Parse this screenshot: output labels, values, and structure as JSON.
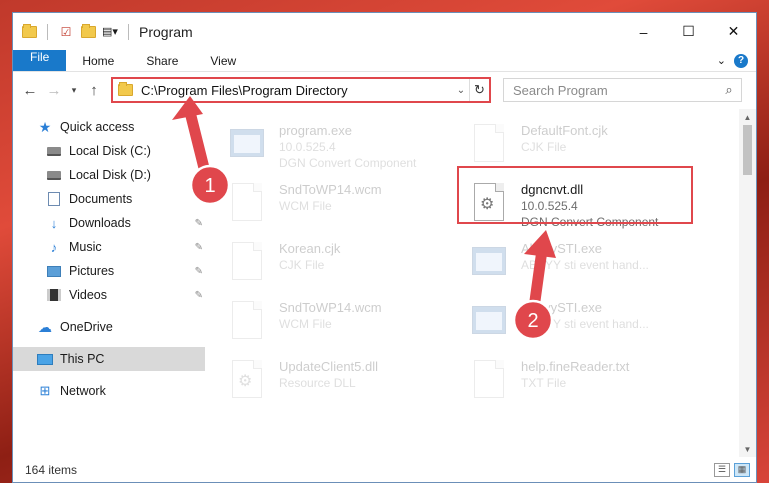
{
  "window": {
    "title": "Program"
  },
  "controls": {
    "minimize": "–",
    "maximize": "☐",
    "close": "✕"
  },
  "ribbon": {
    "tabs": [
      "File",
      "Home",
      "Share",
      "View"
    ]
  },
  "address": {
    "path": "C:\\Program Files\\Program Directory"
  },
  "search": {
    "placeholder": "Search Program"
  },
  "sidebar": {
    "items": [
      {
        "label": "Quick access"
      },
      {
        "label": "Local Disk (C:)"
      },
      {
        "label": "Local Disk (D:)"
      },
      {
        "label": "Documents"
      },
      {
        "label": "Downloads"
      },
      {
        "label": "Music"
      },
      {
        "label": "Pictures"
      },
      {
        "label": "Videos"
      },
      {
        "label": "OneDrive"
      },
      {
        "label": "This PC"
      },
      {
        "label": "Network"
      }
    ]
  },
  "files": [
    {
      "name": "program.exe",
      "line1": "10.0.525.4",
      "line2": "DGN Convert Component"
    },
    {
      "name": "DefaultFont.cjk",
      "line1": "CJK File"
    },
    {
      "name": "SndToWP14.wcm",
      "line1": "WCM File"
    },
    {
      "name": "dgncnvt.dll",
      "line1": "10.0.525.4",
      "line2": "DGN Convert Component"
    },
    {
      "name": "Korean.cjk",
      "line1": "CJK File"
    },
    {
      "name": "AbbyySTI.exe",
      "line1": "ABBYY sti event hand..."
    },
    {
      "name": "SndToWP14.wcm",
      "line1": "WCM File"
    },
    {
      "name": "AbbyySTI.exe",
      "line1": "ABBYY sti event hand..."
    },
    {
      "name": "UpdateClient5.dll",
      "line1": "Resource DLL"
    },
    {
      "name": "help.fineReader.txt",
      "line1": "TXT File"
    }
  ],
  "status": {
    "count": "164 items"
  },
  "annotations": {
    "step1": "1",
    "step2": "2"
  },
  "colors": {
    "highlight": "#e0474c",
    "accent": "#1979ca"
  }
}
